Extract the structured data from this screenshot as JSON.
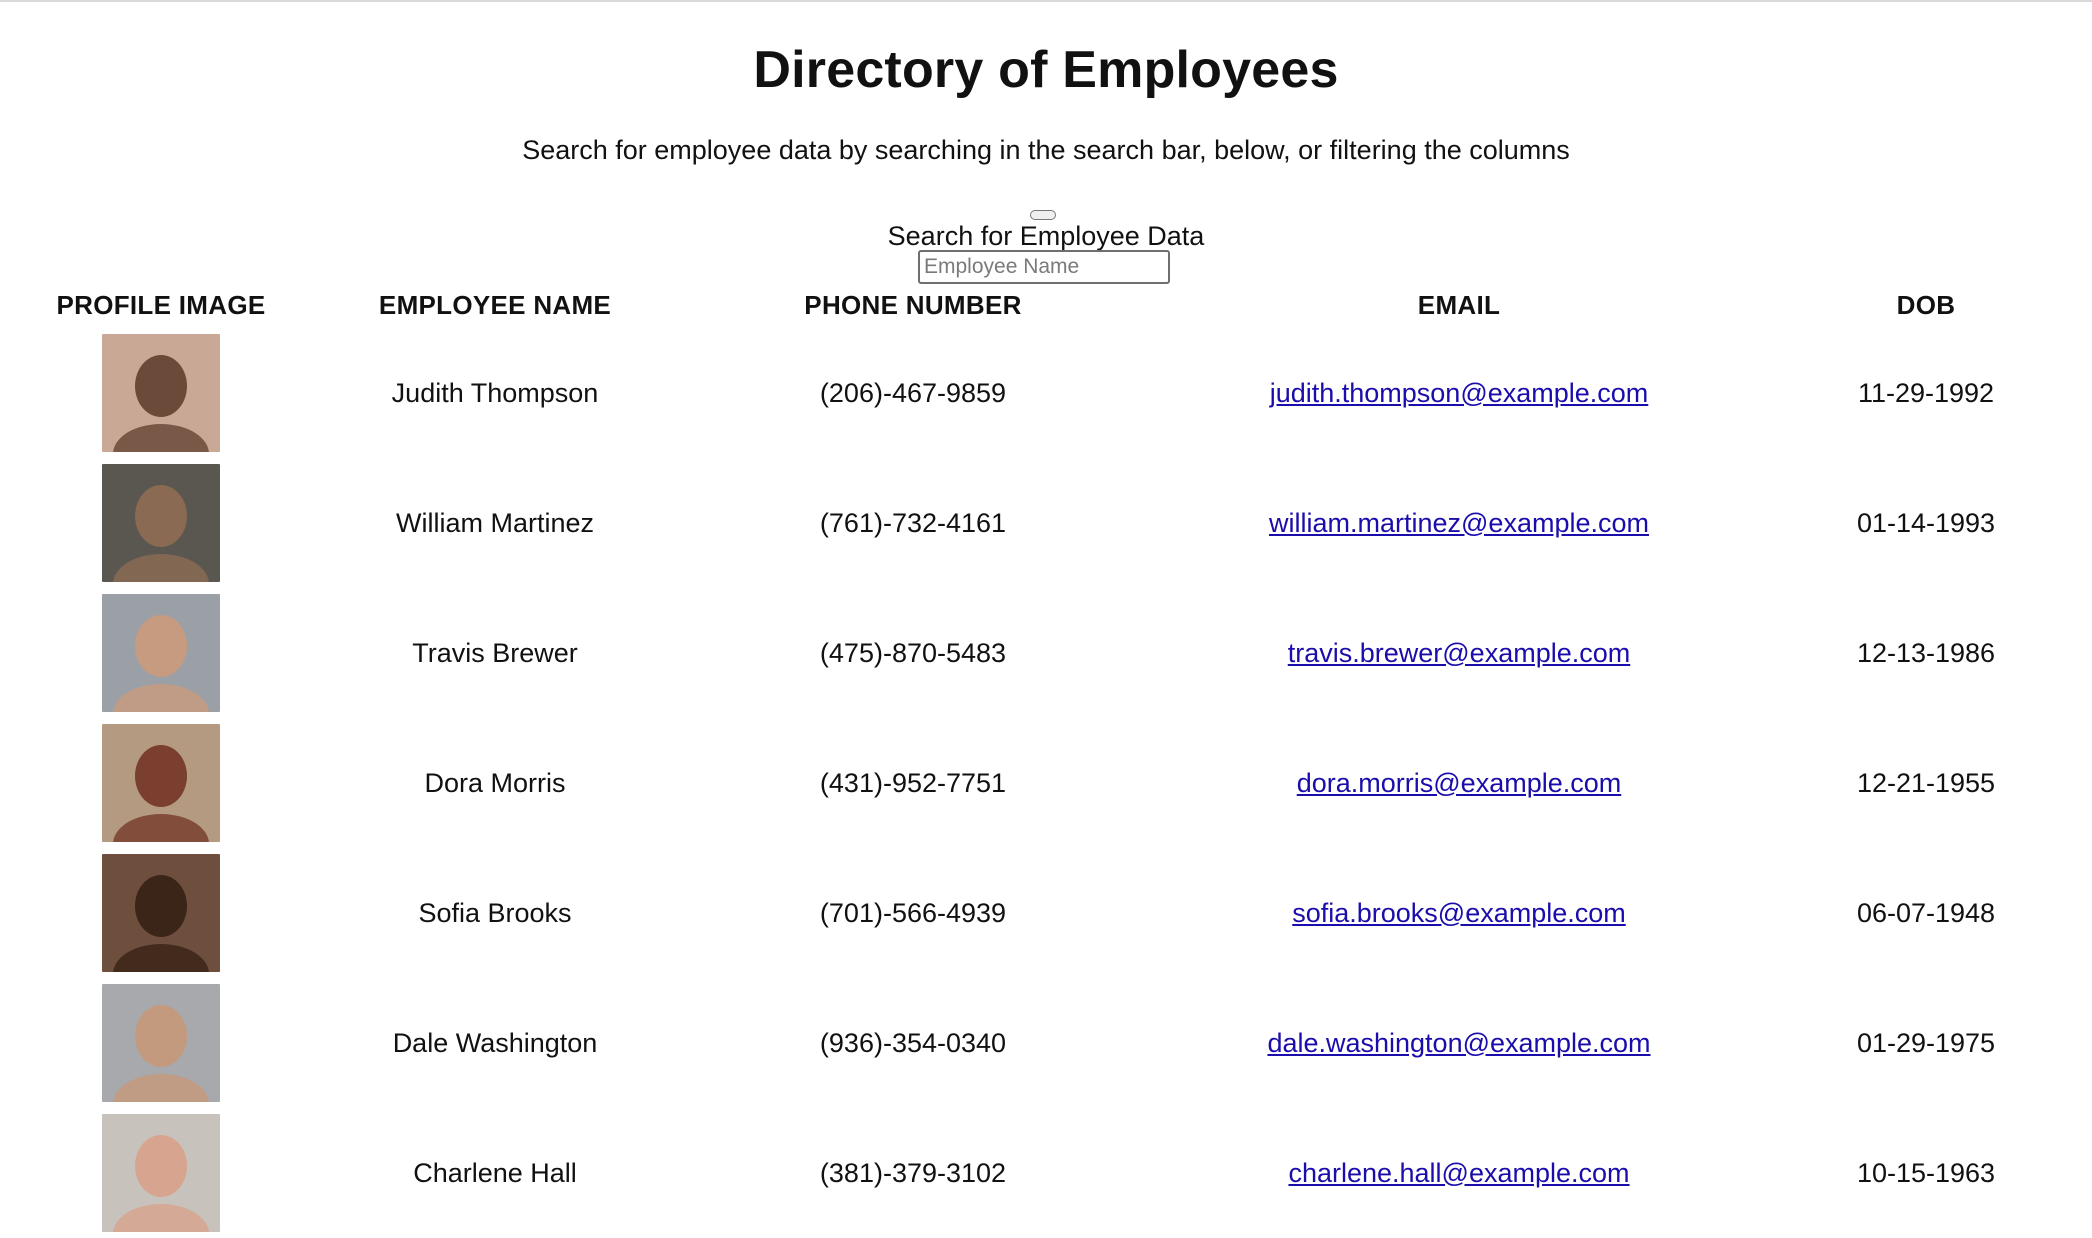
{
  "page": {
    "title": "Directory of Employees",
    "subtitle": "Search for employee data by searching in the search bar, below, or filtering the columns"
  },
  "search": {
    "label": "Search for Employee Data",
    "placeholder": "Employee Name",
    "value": ""
  },
  "table": {
    "columns": [
      "PROFILE IMAGE",
      "EMPLOYEE NAME",
      "PHONE NUMBER",
      "EMAIL",
      "DOB"
    ],
    "rows": [
      {
        "name": "Judith Thompson",
        "phone": "(206)-467-9859",
        "email": "judith.thompson@example.com",
        "dob": "11-29-1992",
        "avatar_bg": "#c9a995",
        "avatar_fg": "#6b4a3a"
      },
      {
        "name": "William Martinez",
        "phone": "(761)-732-4161",
        "email": "william.martinez@example.com",
        "dob": "01-14-1993",
        "avatar_bg": "#5a5650",
        "avatar_fg": "#8a6a52"
      },
      {
        "name": "Travis Brewer",
        "phone": "(475)-870-5483",
        "email": "travis.brewer@example.com",
        "dob": "12-13-1986",
        "avatar_bg": "#9b9fa6",
        "avatar_fg": "#c79b80"
      },
      {
        "name": "Dora Morris",
        "phone": "(431)-952-7751",
        "email": "dora.morris@example.com",
        "dob": "12-21-1955",
        "avatar_bg": "#b59a82",
        "avatar_fg": "#7a3f2f"
      },
      {
        "name": "Sofia Brooks",
        "phone": "(701)-566-4939",
        "email": "sofia.brooks@example.com",
        "dob": "06-07-1948",
        "avatar_bg": "#6e4f3e",
        "avatar_fg": "#3b2418"
      },
      {
        "name": "Dale Washington",
        "phone": "(936)-354-0340",
        "email": "dale.washington@example.com",
        "dob": "01-29-1975",
        "avatar_bg": "#a7a9ad",
        "avatar_fg": "#c49a7e"
      },
      {
        "name": "Charlene Hall",
        "phone": "(381)-379-3102",
        "email": "charlene.hall@example.com",
        "dob": "10-15-1963",
        "avatar_bg": "#c7c2bb",
        "avatar_fg": "#d6a48f"
      }
    ]
  },
  "colors": {
    "link": "#1a0dab",
    "text": "#111111"
  }
}
